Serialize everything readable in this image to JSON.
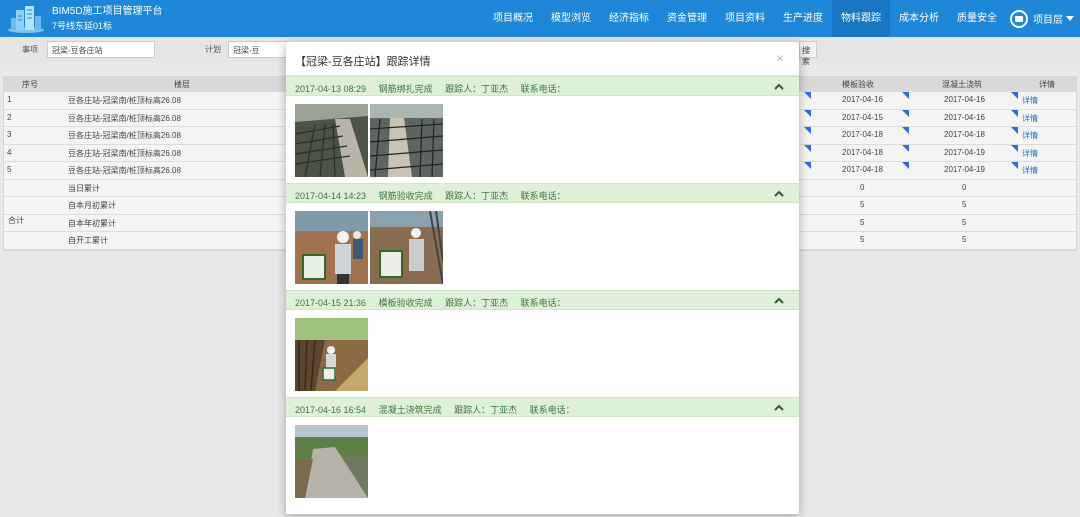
{
  "header": {
    "app_title": "BIM5D施工项目管理平台",
    "subtitle": "7号线东延01标",
    "nav": [
      "项目概况",
      "模型浏览",
      "经济指标",
      "资金管理",
      "项目资料",
      "生产进度",
      "物料跟踪",
      "成本分析",
      "质量安全"
    ],
    "active_nav": "物料跟踪",
    "project_label": "项目层"
  },
  "filters": {
    "item_label": "事项",
    "item_value": "冠梁-豆各庄站",
    "plan_label": "计划",
    "plan_value": "冠梁-豆",
    "search_label": "搜索"
  },
  "table": {
    "headers": [
      "序号",
      "楼层",
      "模板验收",
      "混凝土浇筑",
      "详情"
    ],
    "rows": [
      {
        "index": "1",
        "name": "豆各庄站-冠梁南/桩顶标高26.08",
        "formwork": "2017-04-16",
        "concrete": "2017-04-16",
        "detail": "详情"
      },
      {
        "index": "2",
        "name": "豆各庄站-冠梁南/桩顶标高26.08",
        "formwork": "2017-04-15",
        "concrete": "2017-04-16",
        "detail": "详情"
      },
      {
        "index": "3",
        "name": "豆各庄站-冠梁南/桩顶标高26.08",
        "formwork": "2017-04-18",
        "concrete": "2017-04-18",
        "detail": "详情"
      },
      {
        "index": "4",
        "name": "豆各庄站-冠梁南/桩顶标高26.08",
        "formwork": "2017-04-18",
        "concrete": "2017-04-19",
        "detail": "详情"
      },
      {
        "index": "5",
        "name": "豆各庄站-冠梁南/桩顶标高26.08",
        "formwork": "2017-04-18",
        "concrete": "2017-04-19",
        "detail": "详情"
      }
    ],
    "summary_label": "合计",
    "summary": [
      {
        "name": "当日累计",
        "formwork": "0",
        "concrete": "0"
      },
      {
        "name": "自本月初累计",
        "formwork": "5",
        "concrete": "5"
      },
      {
        "name": "自本年初累计",
        "formwork": "5",
        "concrete": "5"
      },
      {
        "name": "自开工累计",
        "formwork": "5",
        "concrete": "5"
      }
    ]
  },
  "modal": {
    "title": "【冠梁-豆各庄站】跟踪详情",
    "close": "×",
    "sections": [
      {
        "datetime": "2017-04-13 08:29",
        "status": "钢筋绑扎完成",
        "tracker": "跟踪人：丁亚杰",
        "phone": "联系电话："
      },
      {
        "datetime": "2017-04-14 14:23",
        "status": "钢筋验收完成",
        "tracker": "跟踪人：丁亚杰",
        "phone": "联系电话："
      },
      {
        "datetime": "2017-04-15 21:36",
        "status": "模板验收完成",
        "tracker": "跟踪人：丁亚杰",
        "phone": "联系电话："
      },
      {
        "datetime": "2017-04-16 16:54",
        "status": "混凝土浇筑完成",
        "tracker": "跟踪人：丁亚杰",
        "phone": "联系电话："
      }
    ]
  },
  "colors": {
    "header_blue": "#1f87d8",
    "active_nav": "#1876c2",
    "section_green": "#dff0d8",
    "section_text": "#3c763d"
  }
}
